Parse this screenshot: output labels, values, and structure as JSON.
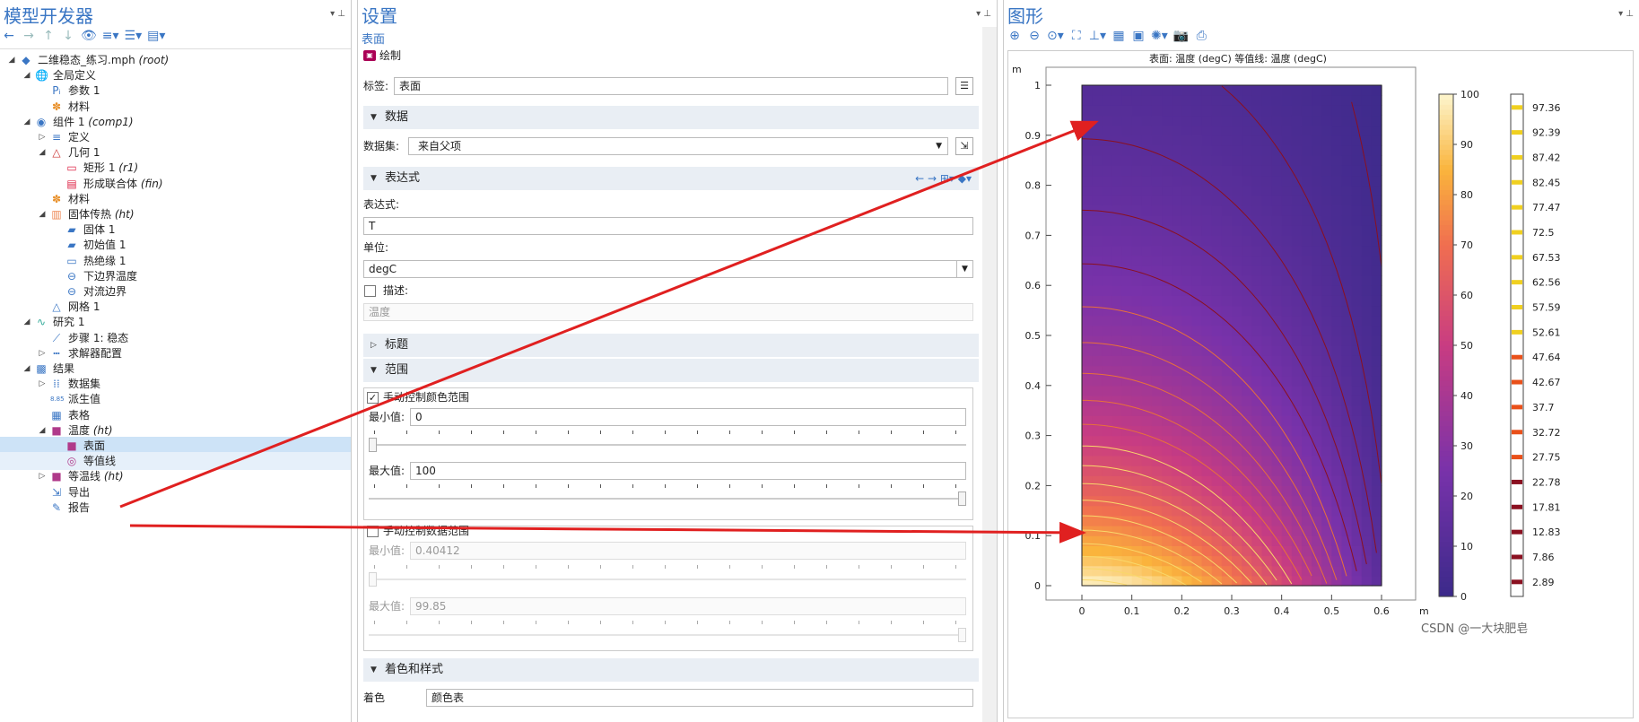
{
  "left_panel": {
    "title": "模型开发器",
    "tree": [
      {
        "label": "二维稳态_练习.mph",
        "tag": "(root)",
        "icon": "model-icon",
        "depth": 0,
        "toggle": "▲"
      },
      {
        "label": "全局定义",
        "tag": "",
        "icon": "globe-icon",
        "depth": 1,
        "toggle": "▲"
      },
      {
        "label": "参数 1",
        "tag": "",
        "icon": "parameters-icon",
        "depth": 2,
        "toggle": ""
      },
      {
        "label": "材料",
        "tag": "",
        "icon": "materials-icon",
        "depth": 2,
        "toggle": ""
      },
      {
        "label": "组件 1",
        "tag": "(comp1)",
        "icon": "component-icon",
        "depth": 1,
        "toggle": "▲"
      },
      {
        "label": "定义",
        "tag": "",
        "icon": "definitions-icon",
        "depth": 2,
        "toggle": "▷"
      },
      {
        "label": "几何 1",
        "tag": "",
        "icon": "geometry-icon",
        "depth": 2,
        "toggle": "▲"
      },
      {
        "label": "矩形 1",
        "tag": "(r1)",
        "icon": "rectangle-icon",
        "depth": 3,
        "toggle": ""
      },
      {
        "label": "形成联合体",
        "tag": "(fin)",
        "icon": "form-union-icon",
        "depth": 3,
        "toggle": ""
      },
      {
        "label": "材料",
        "tag": "",
        "icon": "materials-icon",
        "depth": 2,
        "toggle": ""
      },
      {
        "label": "固体传热",
        "tag": "(ht)",
        "icon": "heat-transfer-icon",
        "depth": 2,
        "toggle": "▲"
      },
      {
        "label": "固体 1",
        "tag": "",
        "icon": "solid-icon",
        "depth": 3,
        "toggle": ""
      },
      {
        "label": "初始值 1",
        "tag": "",
        "icon": "initial-values-icon",
        "depth": 3,
        "toggle": ""
      },
      {
        "label": "热绝缘 1",
        "tag": "",
        "icon": "thermal-insulation-icon",
        "depth": 3,
        "toggle": ""
      },
      {
        "label": "下边界温度",
        "tag": "",
        "icon": "boundary-icon",
        "depth": 3,
        "toggle": ""
      },
      {
        "label": "对流边界",
        "tag": "",
        "icon": "boundary-icon",
        "depth": 3,
        "toggle": ""
      },
      {
        "label": "网格 1",
        "tag": "",
        "icon": "mesh-icon",
        "depth": 2,
        "toggle": ""
      },
      {
        "label": "研究 1",
        "tag": "",
        "icon": "study-icon",
        "depth": 1,
        "toggle": "▲"
      },
      {
        "label": "步骤 1: 稳态",
        "tag": "",
        "icon": "step-icon",
        "depth": 2,
        "toggle": ""
      },
      {
        "label": "求解器配置",
        "tag": "",
        "icon": "solver-icon",
        "depth": 2,
        "toggle": "▷"
      },
      {
        "label": "结果",
        "tag": "",
        "icon": "results-icon",
        "depth": 1,
        "toggle": "▲"
      },
      {
        "label": "数据集",
        "tag": "",
        "icon": "datasets-icon",
        "depth": 2,
        "toggle": "▷"
      },
      {
        "label": "派生值",
        "tag": "",
        "icon": "derived-values-icon",
        "depth": 2,
        "toggle": ""
      },
      {
        "label": "表格",
        "tag": "",
        "icon": "table-icon",
        "depth": 2,
        "toggle": ""
      },
      {
        "label": "温度",
        "tag": "(ht)",
        "icon": "plot-group-icon",
        "depth": 2,
        "toggle": "▲"
      },
      {
        "label": "表面",
        "tag": "",
        "icon": "surface-icon",
        "depth": 3,
        "toggle": "",
        "selected": true
      },
      {
        "label": "等值线",
        "tag": "",
        "icon": "contour-icon",
        "depth": 3,
        "toggle": "",
        "highlighted": true
      },
      {
        "label": "等温线",
        "tag": "(ht)",
        "icon": "plot-group-icon",
        "depth": 2,
        "toggle": "▷"
      },
      {
        "label": "导出",
        "tag": "",
        "icon": "export-icon",
        "depth": 2,
        "toggle": ""
      },
      {
        "label": "报告",
        "tag": "",
        "icon": "report-icon",
        "depth": 2,
        "toggle": ""
      }
    ]
  },
  "settings": {
    "title": "设置",
    "subtitle": "表面",
    "plot_button": "绘制",
    "label_caption": "标签:",
    "label_value": "表面",
    "sections": {
      "data": "数据",
      "expression": "表达式",
      "title": "标题",
      "range": "范围",
      "coloring": "着色和样式"
    },
    "dataset_caption": "数据集:",
    "dataset_value": "来自父项",
    "expression_caption": "表达式:",
    "expression_value": "T",
    "unit_caption": "单位:",
    "unit_value": "degC",
    "description_caption": "描述:",
    "description_value": "温度",
    "manual_color_range": "手动控制颜色范围",
    "manual_data_range": "手动控制数据范围",
    "min_caption": "最小值:",
    "max_caption": "最大值:",
    "color_min": "0",
    "color_max": "100",
    "data_min": "0.40412",
    "data_max": "99.85",
    "coloring_caption": "着色",
    "coloring_value": "颜色表"
  },
  "graphics": {
    "title": "图形",
    "plot_title": "表面: 温度 (degC)  等值线: 温度 (degC)",
    "x_unit": "m",
    "y_unit": "m",
    "x_ticks": [
      "0",
      "0.1",
      "0.2",
      "0.3",
      "0.4",
      "0.5",
      "0.6"
    ],
    "y_ticks": [
      "0",
      "0.1",
      "0.2",
      "0.3",
      "0.4",
      "0.5",
      "0.6",
      "0.7",
      "0.8",
      "0.9",
      "1"
    ],
    "colorbar_ticks": [
      "0",
      "10",
      "20",
      "30",
      "40",
      "50",
      "60",
      "70",
      "80",
      "90",
      "100"
    ],
    "contour_levels": [
      "2.89",
      "7.86",
      "12.83",
      "17.81",
      "22.78",
      "27.75",
      "32.72",
      "37.7",
      "42.67",
      "47.64",
      "52.61",
      "57.59",
      "62.56",
      "67.53",
      "72.5",
      "77.47",
      "82.45",
      "87.42",
      "92.39",
      "97.36"
    ],
    "watermark": "CSDN @一大块肥皂",
    "colors": {
      "low": "#3b2a8a",
      "mid": "#d9457a",
      "high": "#fde9a8"
    }
  }
}
